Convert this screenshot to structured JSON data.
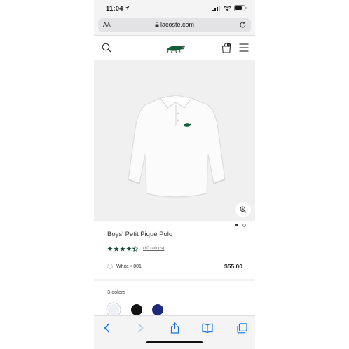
{
  "status_bar": {
    "time": "11:04"
  },
  "browser": {
    "text_size_label": "AA",
    "url": "lacoste.com"
  },
  "product": {
    "title": "Boys' Petit Piqué Polo",
    "rating": 4.5,
    "rating_count_text": "(10 ratings)",
    "color_name": "White • 001",
    "price": "$55.00",
    "colors_count_label": "3 colors",
    "image_pages": {
      "current": 1,
      "total": 2
    },
    "swatches": [
      {
        "name": "white",
        "color": "#eef0f6"
      },
      {
        "name": "black",
        "color": "#121212"
      },
      {
        "name": "navy",
        "color": "#1d2a7a"
      }
    ]
  },
  "colors": {
    "accent_blue": "#1a73e8",
    "star_green": "#1f4f3a",
    "lacoste_green": "#0f5b3a"
  }
}
